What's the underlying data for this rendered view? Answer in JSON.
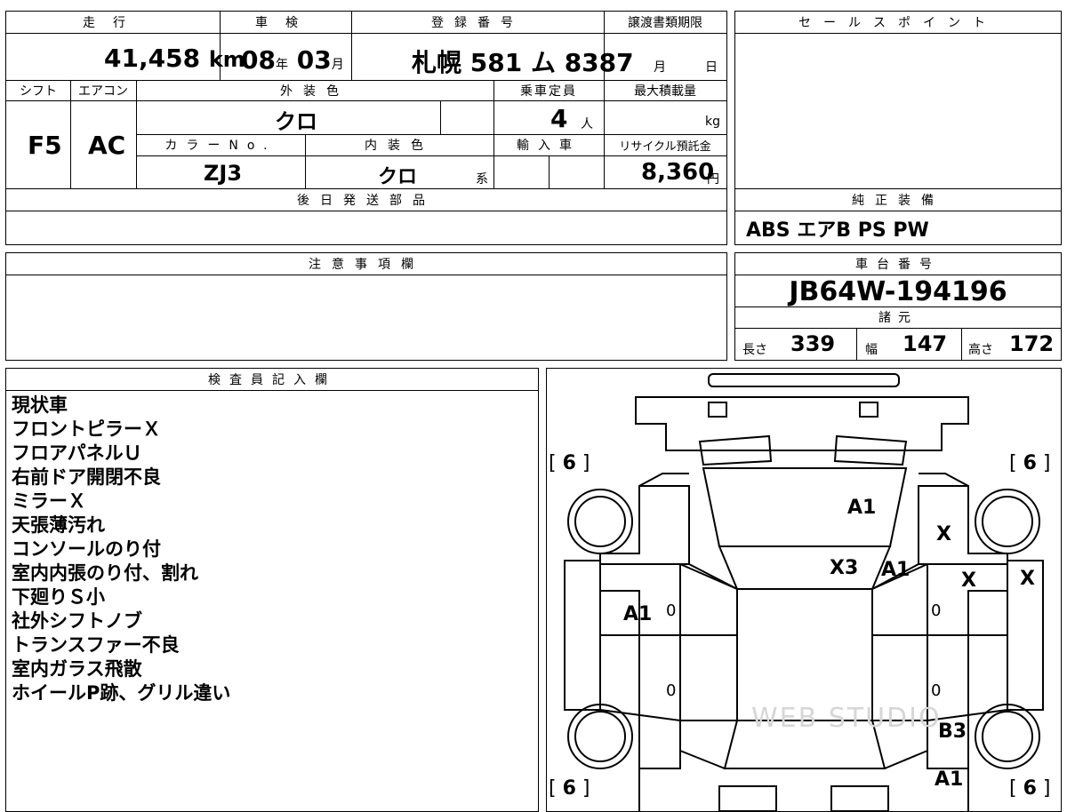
{
  "top": {
    "mileage_label": "走行",
    "mileage_value": "41,458",
    "mileage_unit": "km",
    "inspection_label": "車検",
    "inspection_year": "08",
    "inspection_year_unit": "年",
    "inspection_month": "03",
    "inspection_month_unit": "月",
    "registration_label": "登録番号",
    "registration_value": "札幌 581 ム 8387",
    "transfer_label": "譲渡書類期限",
    "transfer_month_unit": "月",
    "transfer_day_unit": "日"
  },
  "row2": {
    "shift_label": "シフト",
    "shift_value": "F5",
    "ac_label": "エアコン",
    "ac_value": "AC",
    "exterior_color_label": "外装色",
    "exterior_color_value": "クロ",
    "capacity_label": "乗車定員",
    "capacity_value": "4",
    "capacity_unit": "人",
    "max_load_label": "最大積載量",
    "max_load_unit": "kg",
    "color_no_label": "カラーNo.",
    "color_no_value": "ZJ3",
    "interior_color_label": "内装色",
    "interior_color_value": "クロ",
    "interior_color_suffix": "系",
    "import_label": "輸入車",
    "recycle_label": "リサイクル預託金",
    "recycle_value": "8,360",
    "recycle_unit": "円"
  },
  "later_parts": {
    "label": "後日発送部品",
    "value": ""
  },
  "sales_point": {
    "label": "セールスポイント",
    "value": ""
  },
  "equipment": {
    "label": "純正装備",
    "value": "ABS エアB PS PW"
  },
  "notes": {
    "label": "注意事項欄",
    "value": ""
  },
  "chassis": {
    "label": "車台番号",
    "value": "JB64W-194196"
  },
  "specs": {
    "label": "諸元",
    "length_label": "長さ",
    "length_value": "339",
    "width_label": "幅",
    "width_value": "147",
    "height_label": "高さ",
    "height_value": "172"
  },
  "inspector": {
    "label": "検査員記入欄",
    "lines": [
      "現状車",
      "フロントピラーＸ",
      "フロアパネルＵ",
      "右前ドア開閉不良",
      "ミラーＸ",
      "天張薄汚れ",
      "コンソールのり付",
      "室内内張のり付、割れ",
      "下廻りＳ小",
      "社外シフトノブ",
      "トランスファー不良",
      "室内ガラス飛散",
      "ホイールP跡、グリル違い"
    ]
  },
  "diagram": {
    "tire_fl": "6",
    "tire_fr": "6",
    "tire_rl": "6",
    "tire_rr": "6",
    "marks": {
      "hood": "A1",
      "fender_right": "X",
      "pillar_left": "X3",
      "pillar_right": "A1",
      "door_right_front": "X",
      "mirror_right": "X",
      "door_left_front": "A1",
      "zero_lf": "0",
      "zero_lr": "0",
      "zero_rf": "0",
      "zero_rr": "0",
      "rear_fender_right": "B3",
      "rear_right": "A1"
    },
    "watermark": "WEB STUDIO"
  }
}
